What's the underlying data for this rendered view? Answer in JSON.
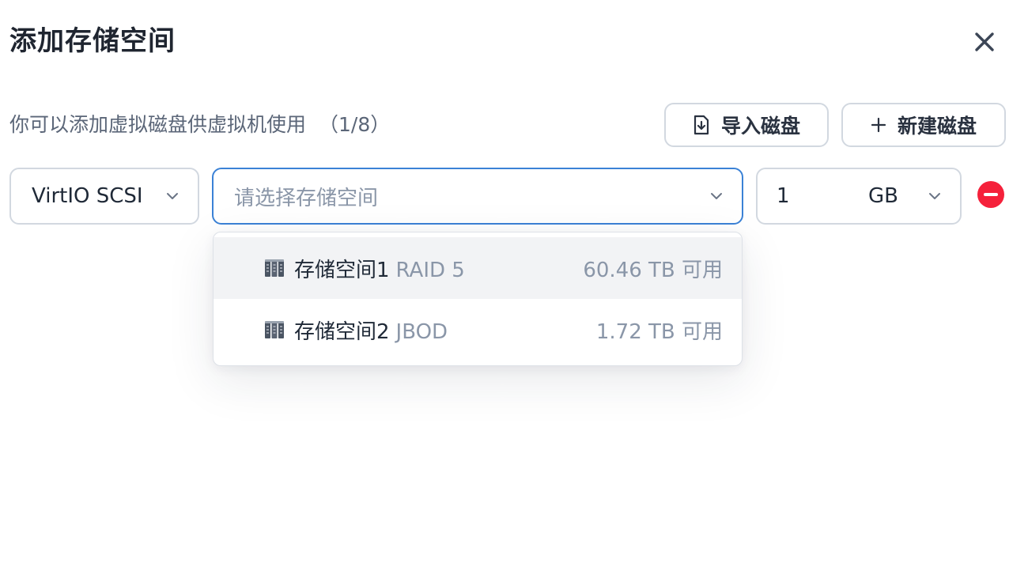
{
  "dialog": {
    "title": "添加存储空间"
  },
  "toolbar": {
    "hint": "你可以添加虚拟磁盘供虚拟机使用",
    "count": "（1/8）",
    "import_label": "导入磁盘",
    "new_label": "新建磁盘"
  },
  "disk_row": {
    "bus_type": "VirtIO SCSI",
    "storage_placeholder": "请选择存储空间",
    "size_value": "1",
    "size_unit": "GB"
  },
  "dropdown": {
    "options": [
      {
        "name": "存储空间1",
        "raid": "RAID 5",
        "available": "60.46 TB 可用"
      },
      {
        "name": "存储空间2",
        "raid": "JBOD",
        "available": "1.72 TB 可用"
      }
    ]
  },
  "colors": {
    "accent_border": "#3b82d6",
    "danger": "#f5213b",
    "muted_text": "#8a96a8"
  }
}
